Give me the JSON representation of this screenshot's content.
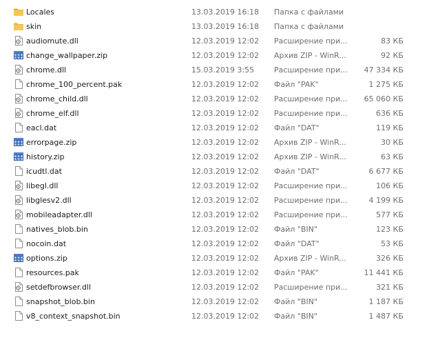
{
  "files": [
    {
      "name": "Locales",
      "date": "13.03.2019 16:18",
      "type": "Папка с файлами",
      "size": "",
      "icon": "folder-icon"
    },
    {
      "name": "skin",
      "date": "13.03.2019 16:18",
      "type": "Папка с файлами",
      "size": "",
      "icon": "folder-icon"
    },
    {
      "name": "audiomute.dll",
      "date": "12.03.2019 12:02",
      "type": "Расширение при...",
      "size": "83 КБ",
      "icon": "dll-file-icon"
    },
    {
      "name": "change_wallpaper.zip",
      "date": "12.03.2019 12:02",
      "type": "Архив ZIP - WinR...",
      "size": "92 КБ",
      "icon": "zip-archive-icon"
    },
    {
      "name": "chrome.dll",
      "date": "15.03.2019 3:55",
      "type": "Расширение при...",
      "size": "47 334 КБ",
      "icon": "dll-file-icon"
    },
    {
      "name": "chrome_100_percent.pak",
      "date": "12.03.2019 12:02",
      "type": "Файл \"PAK\"",
      "size": "1 275 КБ",
      "icon": "blank-file-icon"
    },
    {
      "name": "chrome_child.dll",
      "date": "12.03.2019 12:02",
      "type": "Расширение при...",
      "size": "65 060 КБ",
      "icon": "dll-file-icon"
    },
    {
      "name": "chrome_elf.dll",
      "date": "12.03.2019 12:02",
      "type": "Расширение при...",
      "size": "636 КБ",
      "icon": "dll-file-icon"
    },
    {
      "name": "eacl.dat",
      "date": "12.03.2019 12:02",
      "type": "Файл \"DAT\"",
      "size": "119 КБ",
      "icon": "blank-file-icon"
    },
    {
      "name": "errorpage.zip",
      "date": "12.03.2019 12:02",
      "type": "Архив ZIP - WinR...",
      "size": "30 КБ",
      "icon": "zip-archive-icon"
    },
    {
      "name": "history.zip",
      "date": "12.03.2019 12:02",
      "type": "Архив ZIP - WinR...",
      "size": "63 КБ",
      "icon": "zip-archive-icon"
    },
    {
      "name": "icudtl.dat",
      "date": "12.03.2019 12:02",
      "type": "Файл \"DAT\"",
      "size": "6 677 КБ",
      "icon": "blank-file-icon"
    },
    {
      "name": "libegl.dll",
      "date": "12.03.2019 12:02",
      "type": "Расширение при...",
      "size": "106 КБ",
      "icon": "dll-file-icon"
    },
    {
      "name": "libglesv2.dll",
      "date": "12.03.2019 12:02",
      "type": "Расширение при...",
      "size": "4 199 КБ",
      "icon": "dll-file-icon"
    },
    {
      "name": "mobileadapter.dll",
      "date": "12.03.2019 12:02",
      "type": "Расширение при...",
      "size": "577 КБ",
      "icon": "dll-file-icon"
    },
    {
      "name": "natives_blob.bin",
      "date": "12.03.2019 12:02",
      "type": "Файл \"BIN\"",
      "size": "123 КБ",
      "icon": "blank-file-icon"
    },
    {
      "name": "nocoin.dat",
      "date": "12.03.2019 12:02",
      "type": "Файл \"DAT\"",
      "size": "53 КБ",
      "icon": "blank-file-icon"
    },
    {
      "name": "options.zip",
      "date": "12.03.2019 12:02",
      "type": "Архив ZIP - WinR...",
      "size": "326 КБ",
      "icon": "zip-archive-icon"
    },
    {
      "name": "resources.pak",
      "date": "12.03.2019 12:02",
      "type": "Файл \"PAK\"",
      "size": "11 441 КБ",
      "icon": "blank-file-icon"
    },
    {
      "name": "setdefbrowser.dll",
      "date": "12.03.2019 12:02",
      "type": "Расширение при...",
      "size": "321 КБ",
      "icon": "dll-file-icon"
    },
    {
      "name": "snapshot_blob.bin",
      "date": "12.03.2019 12:02",
      "type": "Файл \"BIN\"",
      "size": "1 187 КБ",
      "icon": "blank-file-icon"
    },
    {
      "name": "v8_context_snapshot.bin",
      "date": "12.03.2019 12:02",
      "type": "Файл \"BIN\"",
      "size": "1 487 КБ",
      "icon": "blank-file-icon"
    }
  ],
  "colors": {
    "name_text": "#1a1a1a",
    "detail_text": "#6d6d6d",
    "folder": "#f0c350",
    "zip": "#2b5aa8"
  }
}
